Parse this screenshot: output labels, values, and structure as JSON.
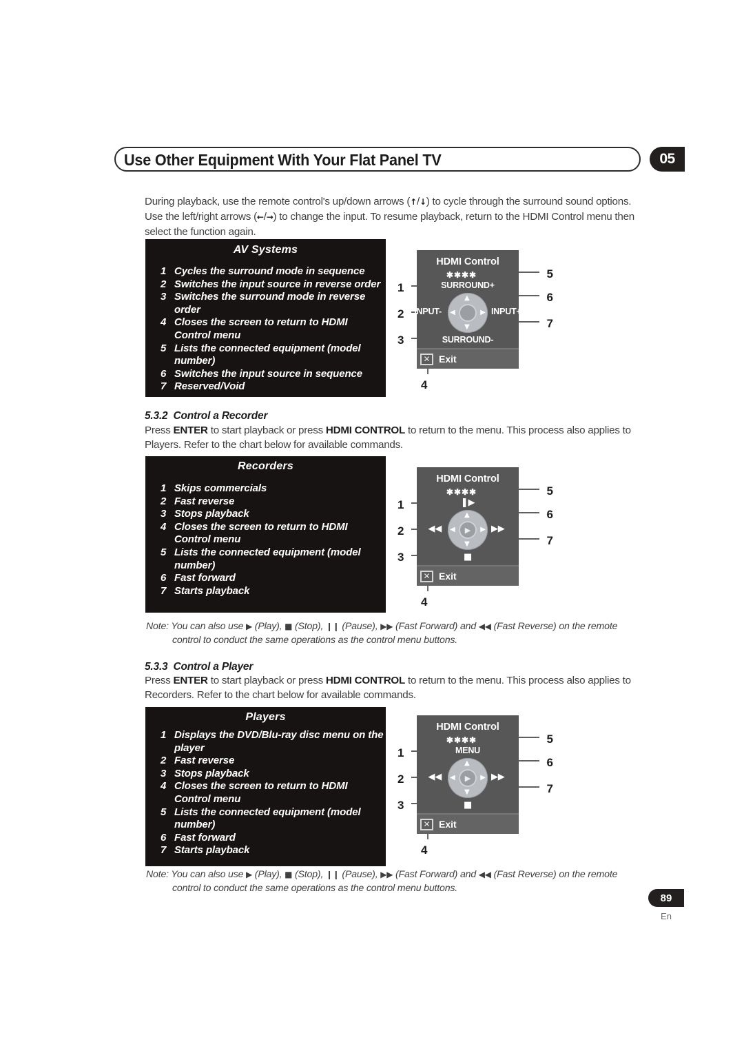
{
  "header": {
    "title": "Use Other Equipment With Your Flat Panel TV",
    "chapter": "05"
  },
  "intro_paragraph": {
    "line1_a": "During playback, use the remote control's up/down arrows (",
    "arrow_up": "↑",
    "slash": "/",
    "arrow_down": "↓",
    "line1_b": ") to cycle through the surround sound options. Use the left/right arrows (",
    "arrow_left": "←",
    "arrow_right": "→",
    "line1_c": ") to change the input. To resume playback, return to the HDMI Control menu then select the function again."
  },
  "sections": [
    {
      "number": "5.3.2",
      "title": "Control a Recorder",
      "body_a": "Press ",
      "body_bold1": "ENTER",
      "body_b": " to start playback or press ",
      "body_bold2": "HDMI CONTROL",
      "body_c": " to return to the menu. This process also applies to Players. Refer to the chart below for available commands."
    },
    {
      "number": "5.3.3",
      "title": "Control a Player",
      "body_a": "Press ",
      "body_bold1": "ENTER",
      "body_b": " to start playback or press ",
      "body_bold2": "HDMI CONTROL",
      "body_c": " to return to the menu. This process also applies to Recorders. Refer to the chart below for available commands."
    }
  ],
  "command_boxes": [
    {
      "title": "AV Systems",
      "items": [
        {
          "index": "1",
          "text": "Cycles the surround mode in sequence"
        },
        {
          "index": "2",
          "text": "Switches the input source in reverse order"
        },
        {
          "index": "3",
          "text": "Switches the surround mode in reverse order"
        },
        {
          "index": "4",
          "text": "Closes the screen to return to HDMI Control menu"
        },
        {
          "index": "5",
          "text": "Lists the connected equipment (model number)"
        },
        {
          "index": "6",
          "text": "Switches the input source in sequence"
        },
        {
          "index": "7",
          "text": "Reserved/Void"
        }
      ]
    },
    {
      "title": "Recorders",
      "items": [
        {
          "index": "1",
          "text": "Skips commercials"
        },
        {
          "index": "2",
          "text": "Fast reverse"
        },
        {
          "index": "3",
          "text": "Stops playback"
        },
        {
          "index": "4",
          "text": "Closes the screen to return to HDMI Control menu"
        },
        {
          "index": "5",
          "text": "Lists the connected equipment (model number)"
        },
        {
          "index": "6",
          "text": "Fast forward"
        },
        {
          "index": "7",
          "text": "Starts playback"
        }
      ]
    },
    {
      "title": "Players",
      "items": [
        {
          "index": "1",
          "text": "Displays the DVD/Blu-ray disc menu on the player"
        },
        {
          "index": "2",
          "text": "Fast reverse"
        },
        {
          "index": "3",
          "text": "Stops playback"
        },
        {
          "index": "4",
          "text": "Closes the screen to return to HDMI Control menu"
        },
        {
          "index": "5",
          "text": "Lists the connected equipment (model number)"
        },
        {
          "index": "6",
          "text": "Fast forward"
        },
        {
          "index": "7",
          "text": "Starts playback"
        }
      ]
    }
  ],
  "diagrams": [
    {
      "panel_title": "HDMI Control",
      "stars": "✱✱✱✱",
      "exit_label": "Exit",
      "label_top": "SURROUND+",
      "label_bottom": "SURROUND-",
      "label_left": "INPUT-",
      "label_right": "INPUT+",
      "center_symbol": "",
      "callouts": [
        "1",
        "2",
        "3",
        "4",
        "5",
        "6",
        "7"
      ]
    },
    {
      "panel_title": "HDMI Control",
      "stars": "✱✱✱✱",
      "exit_label": "Exit",
      "label_top": "❚▶",
      "label_bottom": "■",
      "label_left": "◀◀",
      "label_right": "▶▶",
      "center_symbol": "▶",
      "callouts": [
        "1",
        "2",
        "3",
        "4",
        "5",
        "6",
        "7"
      ]
    },
    {
      "panel_title": "HDMI Control",
      "stars": "✱✱✱✱",
      "exit_label": "Exit",
      "label_top": "MENU",
      "label_bottom": "■",
      "label_left": "◀◀",
      "label_right": "▶▶",
      "center_symbol": "▶",
      "callouts": [
        "1",
        "2",
        "3",
        "4",
        "5",
        "6",
        "7"
      ]
    }
  ],
  "notes": [
    {
      "label": "Note:",
      "line1_a": "You can also use ",
      "sym_play": "▶",
      "t_play": " (Play), ",
      "sym_stop": "■",
      "t_stop": " (Stop), ",
      "sym_pause": "❙❙",
      "t_pause": " (Pause), ",
      "sym_ff": "▶▶",
      "t_ff": " (Fast Forward) and ",
      "sym_fr": "◀◀",
      "t_fr": " (Fast Reverse) on the remote",
      "line2": "control to conduct the same operations as the control menu buttons."
    },
    {
      "label": "Note:",
      "line1_a": "You can also use ",
      "sym_play": "▶",
      "t_play": " (Play), ",
      "sym_stop": "■",
      "t_stop": " (Stop), ",
      "sym_pause": "❙❙",
      "t_pause": " (Pause), ",
      "sym_ff": "▶▶",
      "t_ff": " (Fast Forward) and ",
      "sym_fr": "◀◀",
      "t_fr": " (Fast Reverse) on the remote",
      "line2": "control to conduct the same operations as the control menu buttons."
    }
  ],
  "footer": {
    "page_number": "89",
    "language": "En"
  },
  "colors": {
    "ink": "#3f3f3f",
    "heading_ink": "#1c1c1c",
    "box_black": "#171313",
    "panel_gray": "#575757",
    "exit_gray": "#646464",
    "dpad_gray": "#b9bcc0"
  }
}
